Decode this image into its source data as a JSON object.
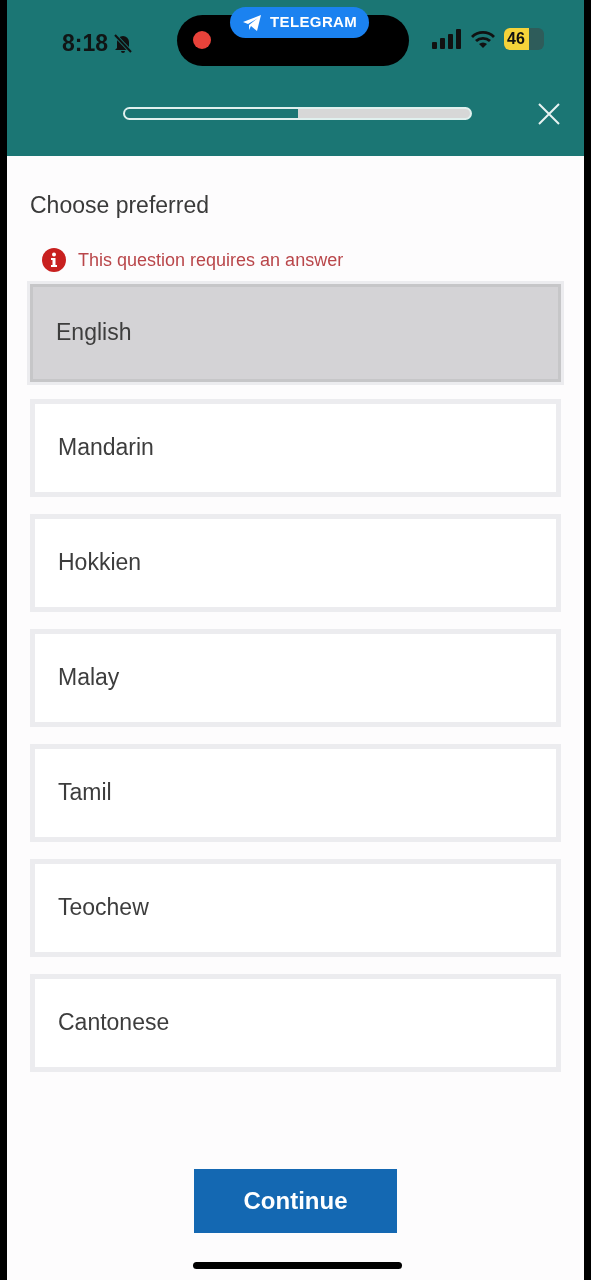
{
  "status_bar": {
    "time": "8:18",
    "silent": true,
    "app_pill": "TELEGRAM",
    "recording": true,
    "battery": "46"
  },
  "progress": {
    "level": 0.5
  },
  "question": {
    "title": "Choose preferred",
    "error": "This question requires an answer"
  },
  "options": [
    {
      "label": "English",
      "selected": true
    },
    {
      "label": "Mandarin",
      "selected": false
    },
    {
      "label": "Hokkien",
      "selected": false
    },
    {
      "label": "Malay",
      "selected": false
    },
    {
      "label": "Tamil",
      "selected": false
    },
    {
      "label": "Teochew",
      "selected": false
    },
    {
      "label": "Cantonese",
      "selected": false
    }
  ],
  "continue_button": "Continue"
}
